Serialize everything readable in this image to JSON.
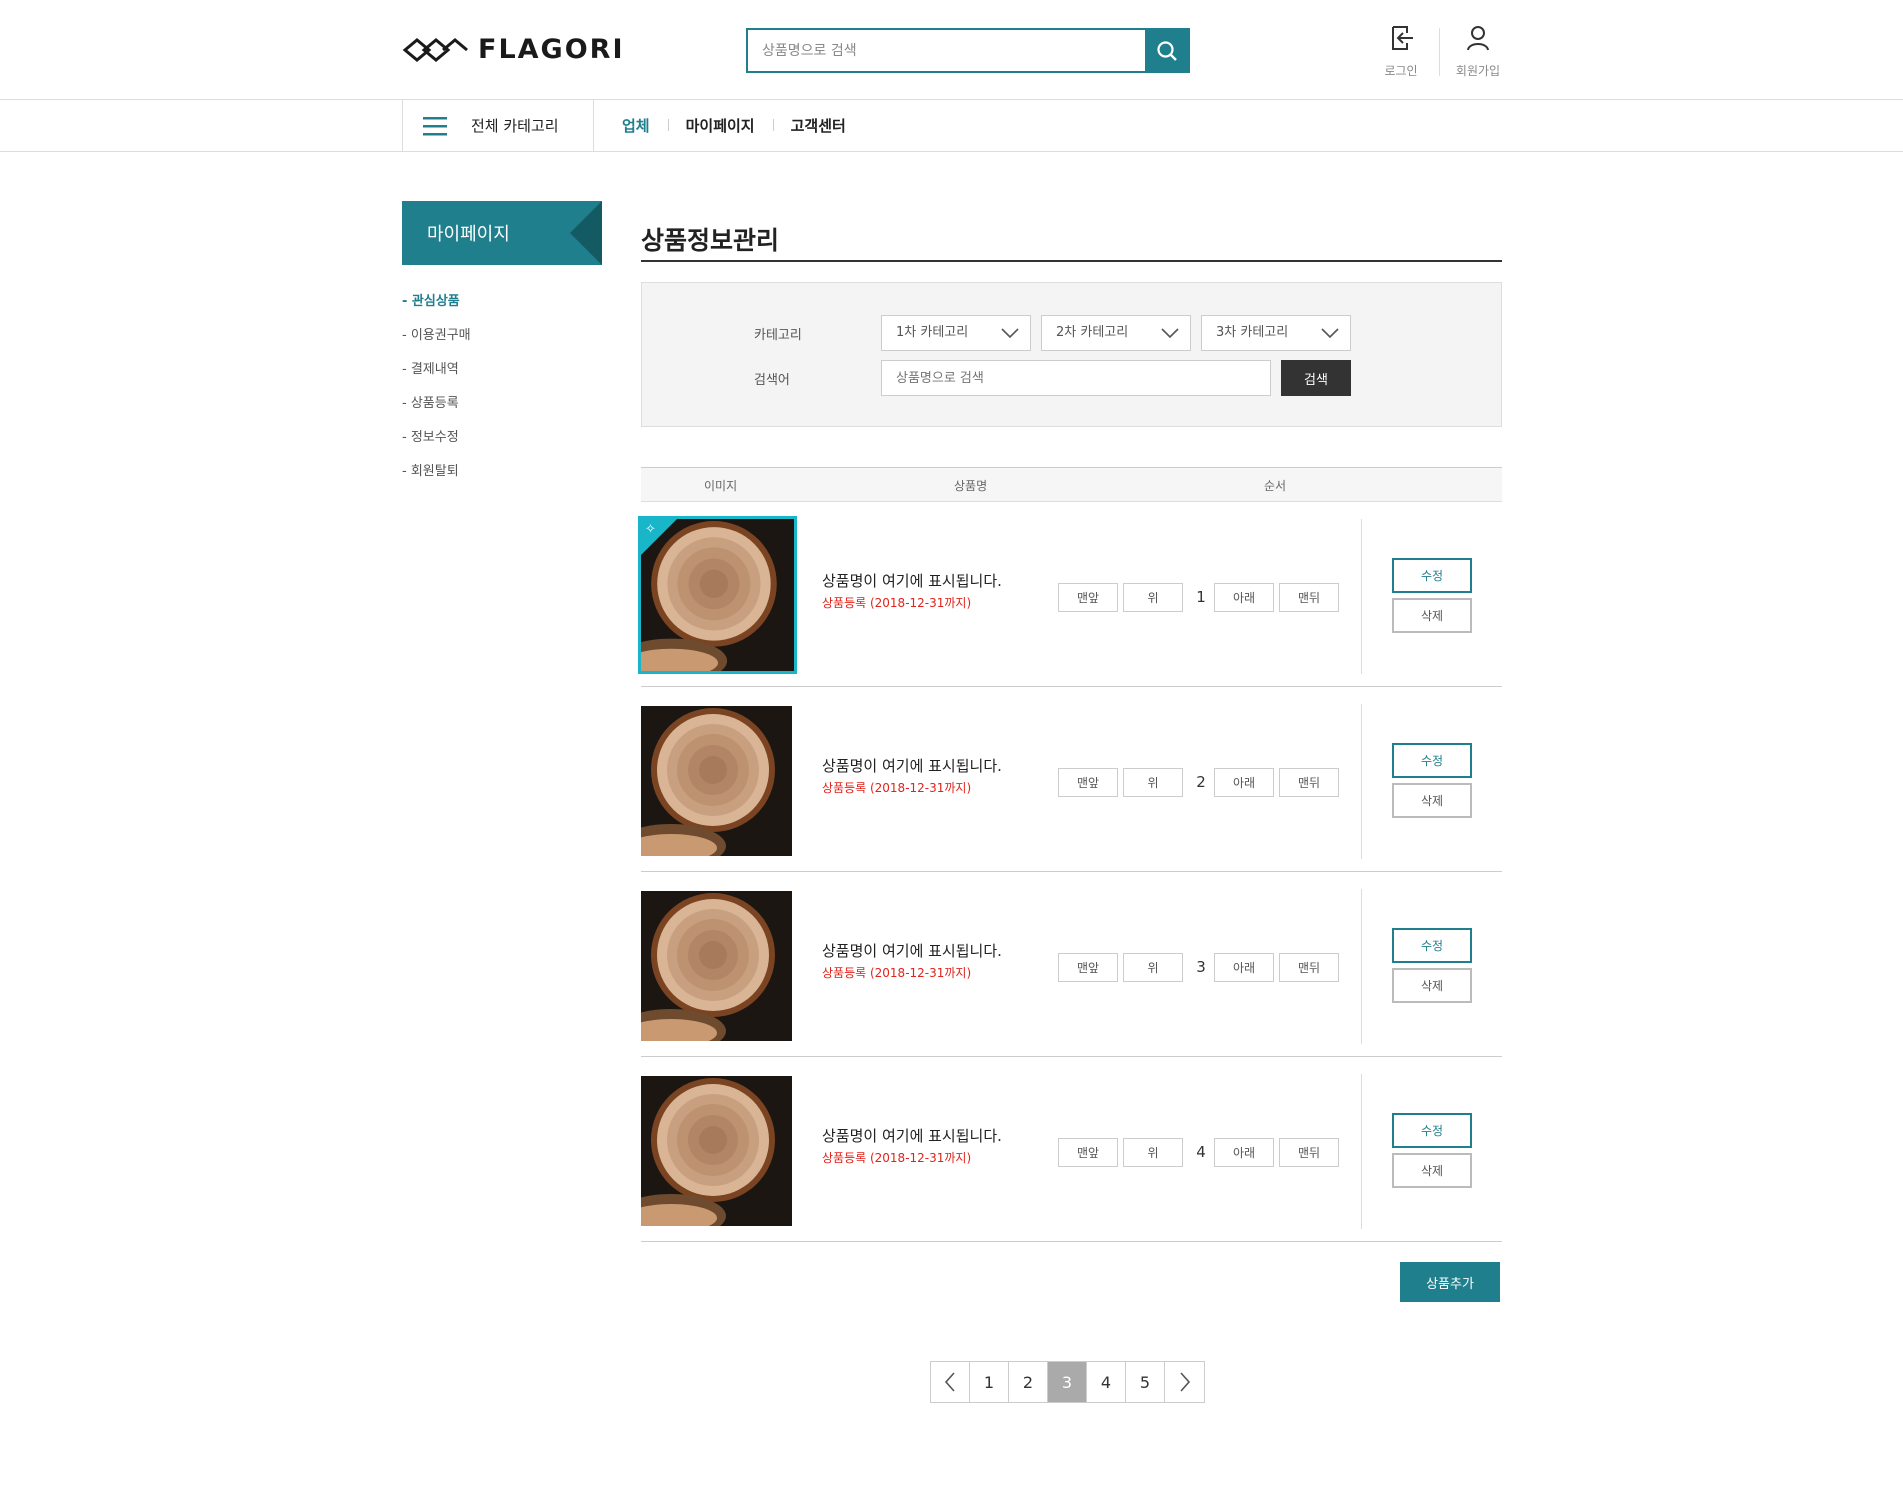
{
  "header": {
    "logo_text": "FLAGORI",
    "search_placeholder": "상품명으로 검색",
    "login_label": "로그인",
    "signup_label": "회원가입"
  },
  "gnb": {
    "all_category": "전체 카테고리",
    "menu": [
      "업체",
      "마이페이지",
      "고객센터"
    ],
    "active_menu": "업체"
  },
  "sidebar": {
    "title": "마이페이지",
    "items": [
      "관심상품",
      "이용권구매",
      "결제내역",
      "상품등록",
      "정보수정",
      "회원탈퇴"
    ],
    "active_item": "관심상품"
  },
  "main": {
    "title": "상품정보관리",
    "filter": {
      "category_label": "카테고리",
      "category1": "1차 카테고리",
      "category2": "2차 카테고리",
      "category3": "3차 카테고리",
      "keyword_label": "검색어",
      "keyword_placeholder": "상품명으로 검색",
      "search_button": "검색"
    },
    "table_headers": [
      "이미지",
      "상품명",
      "순서"
    ],
    "order_buttons": [
      "맨앞",
      "위",
      "아래",
      "맨뒤"
    ],
    "edit_label": "수정",
    "delete_label": "삭제",
    "rows": [
      {
        "name": "상품명이 여기에 표시됩니다.",
        "registration": "상품등록 (2018-12-31까지)",
        "order": "1",
        "selected": true
      },
      {
        "name": "상품명이 여기에 표시됩니다.",
        "registration": "상품등록 (2018-12-31까지)",
        "order": "2",
        "selected": false
      },
      {
        "name": "상품명이 여기에 표시됩니다.",
        "registration": "상품등록 (2018-12-31까지)",
        "order": "3",
        "selected": false
      },
      {
        "name": "상품명이 여기에 표시됩니다.",
        "registration": "상품등록 (2018-12-31까지)",
        "order": "4",
        "selected": false
      }
    ],
    "add_button": "상품추가"
  },
  "pagination": {
    "pages": [
      "1",
      "2",
      "3",
      "4",
      "5"
    ],
    "current": "3"
  },
  "colors": {
    "accent": "#1f7f8c",
    "highlight": "#19b5c9",
    "registration_text": "#e2231a"
  }
}
